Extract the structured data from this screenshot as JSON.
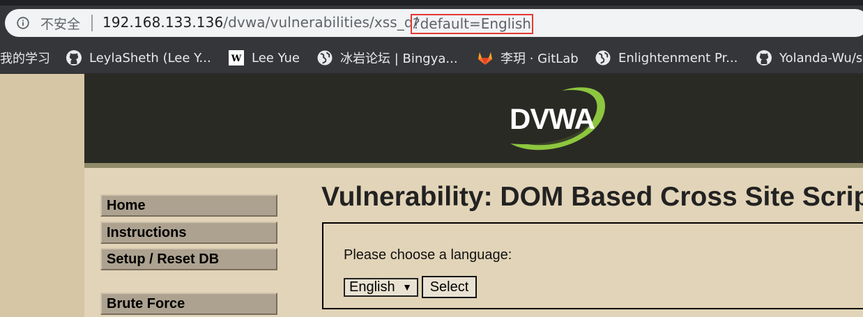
{
  "browser": {
    "security_label": "不安全",
    "url_host": "192.168.133.136",
    "url_path": "/dvwa/vulnerabilities/xss_d/",
    "url_query": "?default=English"
  },
  "bookmarks": [
    {
      "label": "我的学习",
      "icon": "none"
    },
    {
      "label": "LeylaSheth (Lee Y...",
      "icon": "github-icon"
    },
    {
      "label": "Lee Yue",
      "icon": "wordpress-icon"
    },
    {
      "label": "冰岩论坛 | Bingya...",
      "icon": "globe-icon"
    },
    {
      "label": "李玥 · GitLab",
      "icon": "gitlab-icon"
    },
    {
      "label": "Enlightenment Pr...",
      "icon": "globe-icon"
    },
    {
      "label": "Yolanda-Wu/s",
      "icon": "github-icon"
    }
  ],
  "logo_text": "DVWA",
  "menu": {
    "items": [
      "Home",
      "Instructions",
      "Setup / Reset DB",
      "Brute Force"
    ]
  },
  "main": {
    "title": "Vulnerability: DOM Based Cross Site Scrip",
    "prompt": "Please choose a language:",
    "select_value": "English",
    "select_arrow": "▼",
    "submit_label": "Select"
  },
  "colors": {
    "header_bg": "#2a2a25",
    "content_bg": "#e2d4b8",
    "sidebar_bg": "#d6c6a6",
    "highlight_border": "#e53935",
    "logo_swoosh": "#8dc63f"
  }
}
